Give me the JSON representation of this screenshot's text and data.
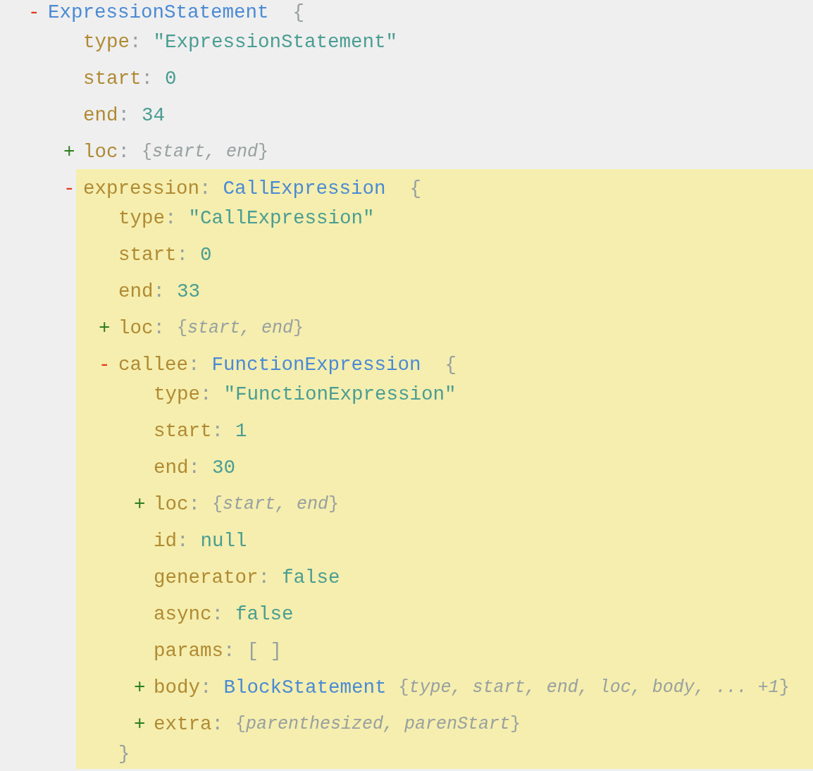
{
  "tree": {
    "kind": "object",
    "toggle": "-",
    "type_name": "ExpressionStatement",
    "open": "{",
    "highlighted": false,
    "children": [
      {
        "kind": "value",
        "key": "type",
        "colon": ":",
        "value": "\"ExpressionStatement\""
      },
      {
        "kind": "value",
        "key": "start",
        "colon": ":",
        "value": "0"
      },
      {
        "kind": "value",
        "key": "end",
        "colon": ":",
        "value": "34"
      },
      {
        "kind": "collapsed",
        "toggle": "+",
        "key": "loc",
        "colon": ":",
        "open": "{",
        "summary": "start, end",
        "close": "}"
      },
      {
        "kind": "object",
        "toggle": "-",
        "key": "expression",
        "colon": ":",
        "type_name": "CallExpression",
        "open": "{",
        "highlighted": true,
        "children": [
          {
            "kind": "value",
            "key": "type",
            "colon": ":",
            "value": "\"CallExpression\""
          },
          {
            "kind": "value",
            "key": "start",
            "colon": ":",
            "value": "0"
          },
          {
            "kind": "value",
            "key": "end",
            "colon": ":",
            "value": "33"
          },
          {
            "kind": "collapsed",
            "toggle": "+",
            "key": "loc",
            "colon": ":",
            "open": "{",
            "summary": "start, end",
            "close": "}"
          },
          {
            "kind": "object",
            "toggle": "-",
            "key": "callee",
            "colon": ":",
            "type_name": "FunctionExpression",
            "open": "{",
            "close": "}",
            "highlighted": false,
            "children": [
              {
                "kind": "value",
                "key": "type",
                "colon": ":",
                "value": "\"FunctionExpression\""
              },
              {
                "kind": "value",
                "key": "start",
                "colon": ":",
                "value": "1"
              },
              {
                "kind": "value",
                "key": "end",
                "colon": ":",
                "value": "30"
              },
              {
                "kind": "collapsed",
                "toggle": "+",
                "key": "loc",
                "colon": ":",
                "open": "{",
                "summary": "start, end",
                "close": "}"
              },
              {
                "kind": "value",
                "key": "id",
                "colon": ":",
                "value": "null"
              },
              {
                "kind": "value",
                "key": "generator",
                "colon": ":",
                "value": "false"
              },
              {
                "kind": "value",
                "key": "async",
                "colon": ":",
                "value": "false"
              },
              {
                "kind": "array",
                "key": "params",
                "colon": ":",
                "value": "[ ]"
              },
              {
                "kind": "collapsed",
                "toggle": "+",
                "key": "body",
                "colon": ":",
                "type_name": "BlockStatement",
                "open": "{",
                "summary": "type, start, end, loc, body, ... +1",
                "close": "}"
              },
              {
                "kind": "collapsed",
                "toggle": "+",
                "key": "extra",
                "colon": ":",
                "open": "{",
                "summary": "parenthesized, parenStart",
                "close": "}"
              }
            ]
          }
        ]
      }
    ]
  }
}
